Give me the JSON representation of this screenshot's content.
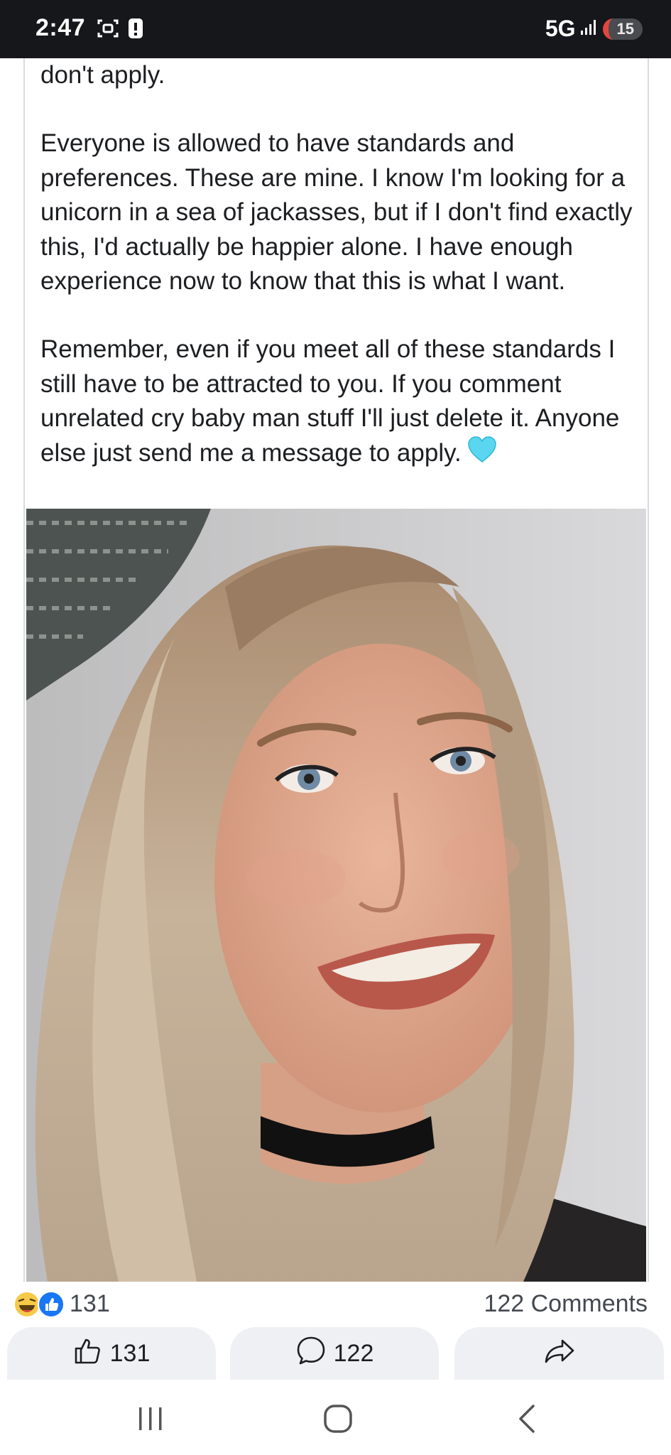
{
  "status_bar": {
    "time": "2:47",
    "network": "5G",
    "battery": "15",
    "icons": [
      "screenshot-icon",
      "alert-icon",
      "signal-icon",
      "battery-icon"
    ]
  },
  "post": {
    "text_cont": "don't apply.",
    "paragraph_1": "Everyone is allowed to have standards and preferences. These are mine. I know I'm looking for a unicorn in a sea of jackasses, but if I don't find exactly this, I'd actually be happier alone. I have enough experience now to know that this is what I want.",
    "paragraph_2": "Remember, even if you meet all of these standards I still have to be attracted to you. If you comment unrelated cry baby man stuff I'll just delete it. Anyone else just send me a message to apply.",
    "emoji": "light-blue-heart-icon"
  },
  "reactions": {
    "count": "131",
    "comments": "122 Comments",
    "icons": [
      "haha-icon",
      "like-icon"
    ]
  },
  "actions": {
    "like_count": "131",
    "comment_count": "122"
  },
  "nav": {
    "icons": [
      "recents-icon",
      "home-icon",
      "back-icon"
    ]
  },
  "colors": {
    "status_bar": "#16171b",
    "like_blue": "#1877f2",
    "heart": "#5ad6f0",
    "button_bg": "#eef0f3"
  }
}
